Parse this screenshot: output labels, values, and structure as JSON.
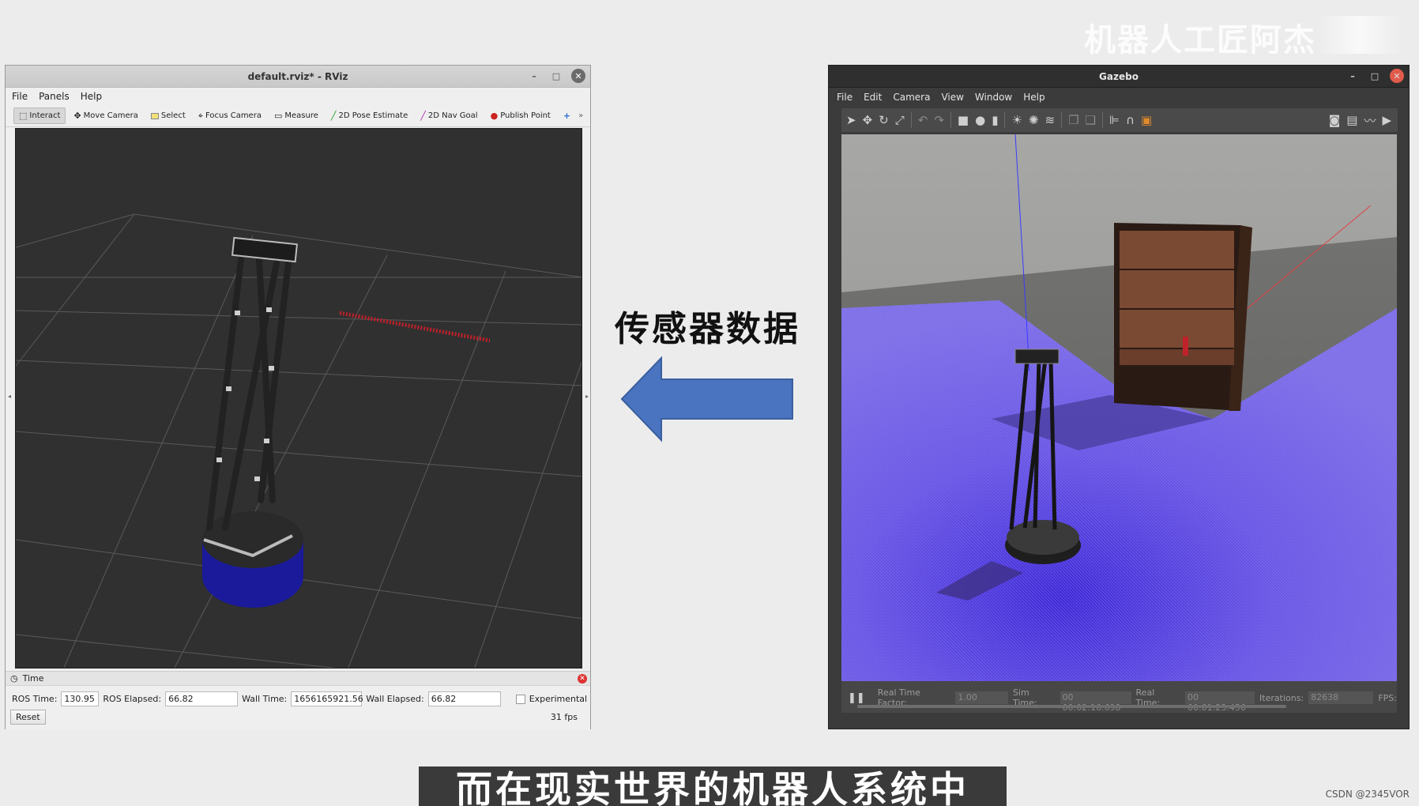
{
  "watermark": "机器人工匠阿杰",
  "rviz": {
    "title": "default.rviz* - RViz",
    "menu": [
      "File",
      "Panels",
      "Help"
    ],
    "tools": [
      {
        "label": "Interact",
        "icon": "interact-icon"
      },
      {
        "label": "Move Camera",
        "icon": "move-camera-icon"
      },
      {
        "label": "Select",
        "icon": "select-icon"
      },
      {
        "label": "Focus Camera",
        "icon": "focus-camera-icon"
      },
      {
        "label": "Measure",
        "icon": "measure-icon"
      },
      {
        "label": "2D Pose Estimate",
        "icon": "pose-estimate-icon"
      },
      {
        "label": "2D Nav Goal",
        "icon": "nav-goal-icon"
      },
      {
        "label": "Publish Point",
        "icon": "publish-point-icon"
      }
    ],
    "time_panel": {
      "title": "Time",
      "ros_time_label": "ROS Time:",
      "ros_time": "130.95",
      "ros_elapsed_label": "ROS Elapsed:",
      "ros_elapsed": "66.82",
      "wall_time_label": "Wall Time:",
      "wall_time": "1656165921.56",
      "wall_elapsed_label": "Wall Elapsed:",
      "wall_elapsed": "66.82",
      "experimental_label": "Experimental",
      "reset_label": "Reset",
      "fps": "31 fps"
    }
  },
  "middle": {
    "label": "传感器数据",
    "arrow_color": "#4a74bf"
  },
  "gazebo": {
    "title": "Gazebo",
    "menu": [
      "File",
      "Edit",
      "Camera",
      "View",
      "Window",
      "Help"
    ],
    "status": {
      "rtf_label": "Real Time Factor:",
      "rtf": "1.00",
      "sim_time_label": "Sim Time:",
      "sim_time": "00 00:02:16.698",
      "real_time_label": "Real Time:",
      "real_time": "00 00:01:23.456",
      "iterations_label": "Iterations:",
      "iterations": "82638",
      "fps_label": "FPS:"
    }
  },
  "subtitle": "而在现实世界的机器人系统中",
  "credit": "CSDN @2345VOR"
}
